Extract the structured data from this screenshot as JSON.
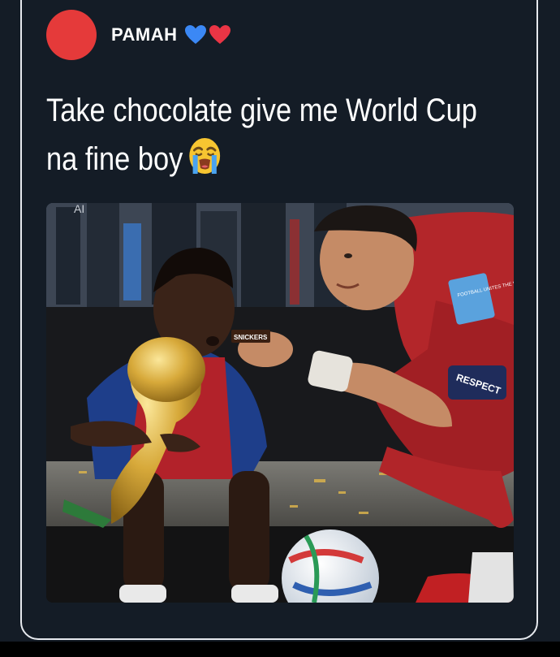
{
  "post": {
    "author": "PAMAH",
    "author_emojis": [
      "blue-heart-icon",
      "red-heart-icon"
    ],
    "text_line1": "Take chocolate give me World Cup",
    "text_line2": "na fine boy",
    "text_emoji": "loudly-crying-face-icon"
  },
  "photo": {
    "kit_badge": "FOOTBALL UNITES THE WORLD",
    "armband": "RESPECT",
    "candy_label": "SNICKERS",
    "banner_fragment": "AI"
  },
  "colors": {
    "background": "#141c26",
    "avatar": "#e53a3a",
    "text": "#ffffff",
    "border": "#e6e9ee"
  }
}
